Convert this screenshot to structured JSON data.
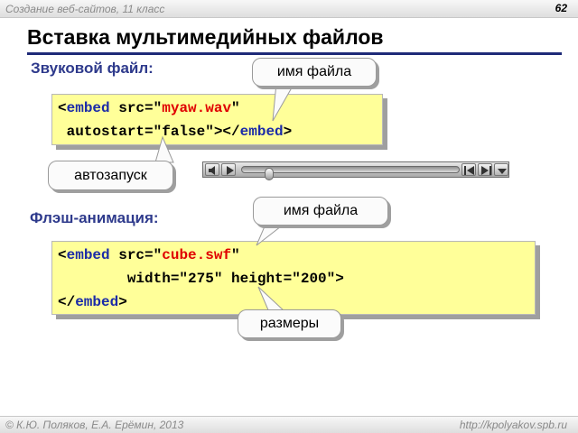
{
  "header": {
    "course": "Создание веб-сайтов, 11 класс",
    "slide_number": "62"
  },
  "title": "Вставка мультимедийных файлов",
  "audio": {
    "heading": "Звуковой файл:",
    "code": {
      "open": "<",
      "tag": "embed",
      "src_attr": " src=\"",
      "src_value": "myaw.wav",
      "quote": "\"",
      "line2_start": " autostart=\"false\"></",
      "close_tag": "embed",
      "close": ">"
    },
    "callout_filename": "имя файла",
    "callout_autostart": "автозапуск"
  },
  "player": {
    "icons": [
      "speaker-icon",
      "play-icon",
      "seek-slider",
      "skip-back-icon",
      "skip-forward-icon",
      "menu-dropdown-icon"
    ],
    "position": 0.11
  },
  "flash": {
    "heading": "Флэш-анимация:",
    "code": {
      "open": "<",
      "tag": "embed",
      "src_attr": " src=\"",
      "src_value": "cube.swf",
      "quote": "\"",
      "line2": "        width=\"275\" height=\"200\">",
      "line3_open": "</",
      "close_tag": "embed",
      "close": ">"
    },
    "callout_filename": "имя файла",
    "callout_sizes": "размеры"
  },
  "footer": {
    "authors": "© К.Ю. Поляков, Е.А. Ерёмин, 2013",
    "url": "http://kpolyakov.spb.ru"
  },
  "colors": {
    "keyword": "#1b2ba8",
    "value": "#e00000",
    "code_bg": "#ffff99",
    "heading": "#2e3a8c",
    "title_rule": "#1e2a78"
  }
}
